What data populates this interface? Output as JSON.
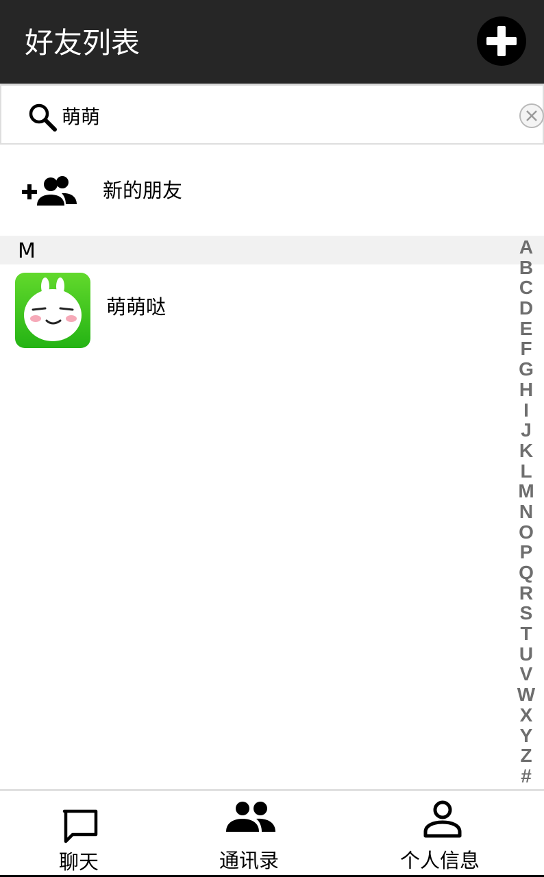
{
  "header": {
    "title": "好友列表",
    "add_icon": "plus-circle-icon"
  },
  "search": {
    "value": "萌萌",
    "search_icon": "search-icon",
    "clear_icon": "clear-circle-icon"
  },
  "new_friend": {
    "label": "新的朋友",
    "icon": "add-group-icon"
  },
  "sections": [
    {
      "letter": "M",
      "contacts": [
        {
          "name": "萌萌哒",
          "avatar": "bunny-avatar"
        }
      ]
    }
  ],
  "index": [
    "A",
    "B",
    "C",
    "D",
    "E",
    "F",
    "G",
    "H",
    "I",
    "J",
    "K",
    "L",
    "M",
    "N",
    "O",
    "P",
    "Q",
    "R",
    "S",
    "T",
    "U",
    "V",
    "W",
    "X",
    "Y",
    "Z",
    "#"
  ],
  "nav": {
    "chat": {
      "label": "聊天",
      "icon": "chat-bubble-icon"
    },
    "contacts": {
      "label": "通讯录",
      "icon": "people-icon"
    },
    "profile": {
      "label": "个人信息",
      "icon": "person-icon"
    }
  },
  "colors": {
    "header_bg": "#262626",
    "section_bg": "#f1f1f1",
    "avatar_green": "#36c11b",
    "index_text": "#6e6e6e"
  }
}
